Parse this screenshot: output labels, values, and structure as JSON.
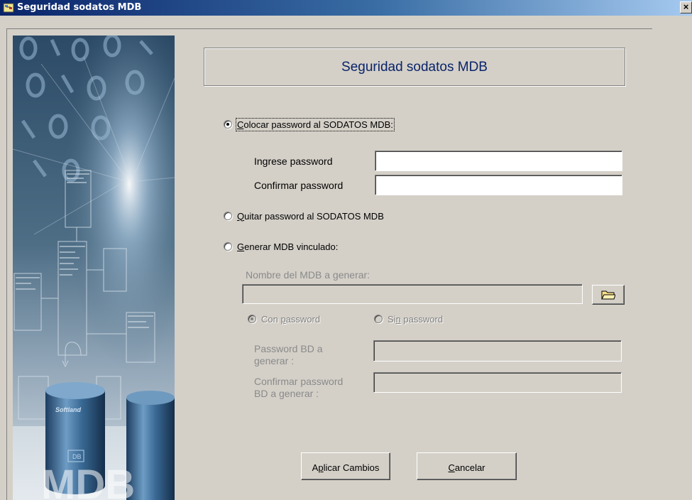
{
  "window": {
    "title": "Seguridad sodatos MDB",
    "close_glyph": "×"
  },
  "header": {
    "title": "Seguridad sodatos MDB"
  },
  "options": {
    "set_password": {
      "label_underlined": "C",
      "label_rest": "olocar  password al SODATOS MDB:",
      "checked": true
    },
    "remove_password": {
      "label_underlined": "Q",
      "label_rest": "uitar password al SODATOS MDB",
      "checked": false
    },
    "generate_linked": {
      "label_underlined": "G",
      "label_rest": "enerar MDB vinculado:",
      "checked": false
    }
  },
  "password_section": {
    "enter_label": "Ingrese password",
    "enter_value": "",
    "confirm_label": "Confirmar password",
    "confirm_value": ""
  },
  "generate_section": {
    "mdb_name_label": "Nombre del MDB a generar:",
    "mdb_name_value": "",
    "with_password": {
      "label_before": "Con ",
      "label_underlined": "p",
      "label_after": "assword",
      "checked": true
    },
    "without_password": {
      "label_before": "Si",
      "label_underlined": "n",
      "label_after": " password",
      "checked": false
    },
    "db_password_label_1": "Password BD a",
    "db_password_label_2": "generar :",
    "db_password_value": "",
    "db_confirm_label_1": "Confirmar password",
    "db_confirm_label_2": "BD a generar :",
    "db_confirm_value": ""
  },
  "buttons": {
    "apply_before": "A",
    "apply_underlined": "p",
    "apply_after": "licar Cambios",
    "cancel_underlined": "C",
    "cancel_after": "ancelar"
  },
  "side_image": {
    "brand_label": "Softland",
    "db_label": "DB",
    "watermark": "MDB"
  },
  "colors": {
    "dialog_background": "#d4d0c8",
    "titlebar_start": "#0a246a",
    "titlebar_end": "#a6caf0",
    "header_text": "#0a246a",
    "disabled_text": "#808080"
  }
}
